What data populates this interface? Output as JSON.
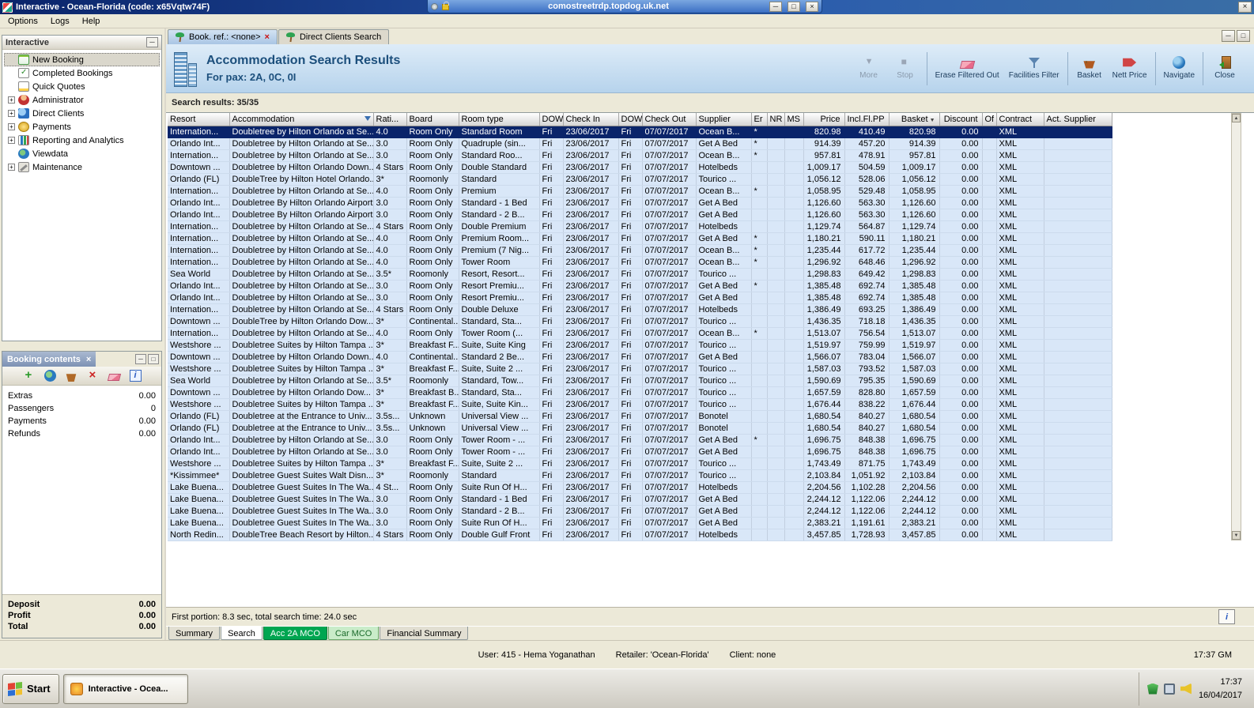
{
  "window": {
    "title": "Interactive - Ocean-Florida (code: x65Vqtw74F)",
    "rdp_title": "comostreetrdp.topdog.uk.net",
    "menu": [
      "Options",
      "Logs",
      "Help"
    ]
  },
  "sidebar": {
    "title": "Interactive",
    "items": [
      {
        "label": "New Booking",
        "icon": "ti-new-booking-icon",
        "expand": "",
        "selected": true
      },
      {
        "label": "Completed Bookings",
        "icon": "ti-completed-bookings-icon",
        "expand": ""
      },
      {
        "label": "Quick Quotes",
        "icon": "ti-quick-quotes-icon",
        "expand": ""
      },
      {
        "label": "Administrator",
        "icon": "ti-administrator-icon",
        "expand": "+"
      },
      {
        "label": "Direct Clients",
        "icon": "ti-direct-clients-icon",
        "expand": "+"
      },
      {
        "label": "Payments",
        "icon": "ti-payments-icon",
        "expand": "+"
      },
      {
        "label": "Reporting and Analytics",
        "icon": "ti-reporting-icon",
        "expand": "+"
      },
      {
        "label": "Viewdata",
        "icon": "ti-viewdata-icon",
        "expand": ""
      },
      {
        "label": "Maintenance",
        "icon": "ti-maintenance-icon",
        "expand": "+"
      }
    ]
  },
  "booking_contents": {
    "title": "Booking contents",
    "toolbar_icons": [
      "add-icon",
      "globe-icon",
      "basket-add-icon",
      "delete-icon",
      "eraser-icon",
      "info-icon"
    ],
    "items": [
      {
        "label": "Extras",
        "value": "0.00"
      },
      {
        "label": "Passengers",
        "value": "0"
      },
      {
        "label": "Payments",
        "value": "0.00"
      },
      {
        "label": "Refunds",
        "value": "0.00"
      }
    ],
    "totals": [
      {
        "label": "Deposit",
        "value": "0.00"
      },
      {
        "label": "Profit",
        "value": "0.00"
      },
      {
        "label": "Total",
        "value": "0.00"
      }
    ]
  },
  "tabs": [
    {
      "label": "Book. ref.: <none>",
      "active": true,
      "closable": true
    },
    {
      "label": "Direct Clients Search",
      "active": false,
      "closable": false
    }
  ],
  "header": {
    "title": "Accommodation Search Results",
    "subtitle": "For pax: 2A, 0C, 0I",
    "toolbar": [
      {
        "label": "More",
        "icon": "more-icon",
        "disabled": true
      },
      {
        "label": "Stop",
        "icon": "stop-icon",
        "disabled": true,
        "sep": true
      },
      {
        "label": "Erase Filtered Out",
        "icon": "eraser-red-icon"
      },
      {
        "label": "Facilities Filter",
        "icon": "filter-icon",
        "sep": true
      },
      {
        "label": "Basket",
        "icon": "basket-brown-icon"
      },
      {
        "label": "Nett Price",
        "icon": "nett-price-icon",
        "sep": true
      },
      {
        "label": "Navigate",
        "icon": "navigate-icon",
        "sep": true
      },
      {
        "label": "Close",
        "icon": "door-icon"
      }
    ]
  },
  "results": {
    "summary": "Search results: 35/35",
    "columns": [
      "Resort",
      "Accommodation",
      "Rati...",
      "Board",
      "Room type",
      "DOW",
      "Check In",
      "DOW",
      "Check Out",
      "Supplier",
      "Er",
      "NR",
      "MS",
      "Price",
      "Incl.Fl.PP",
      "Basket",
      "Discount",
      "Of",
      "Contract",
      "Act. Supplier"
    ],
    "selected_row": 0,
    "status": "First portion: 8.3 sec, total search time: 24.0 sec",
    "rows": [
      [
        "Internation...",
        "Doubletree by Hilton Orlando at Se...",
        "4.0",
        "Room Only",
        "Standard Room",
        "Fri",
        "23/06/2017",
        "Fri",
        "07/07/2017",
        "Ocean B...",
        "*",
        "",
        "",
        "820.98",
        "410.49",
        "820.98",
        "0.00",
        "",
        "XML",
        ""
      ],
      [
        "Orlando Int...",
        "Doubletree by Hilton Orlando at Se...",
        "3.0",
        "Room Only",
        "Quadruple (sin...",
        "Fri",
        "23/06/2017",
        "Fri",
        "07/07/2017",
        "Get A Bed",
        "*",
        "",
        "",
        "914.39",
        "457.20",
        "914.39",
        "0.00",
        "",
        "XML",
        ""
      ],
      [
        "Internation...",
        "Doubletree by Hilton Orlando at Se...",
        "3.0",
        "Room Only",
        "Standard Roo...",
        "Fri",
        "23/06/2017",
        "Fri",
        "07/07/2017",
        "Ocean B...",
        "*",
        "",
        "",
        "957.81",
        "478.91",
        "957.81",
        "0.00",
        "",
        "XML",
        ""
      ],
      [
        "Downtown ...",
        "Doubletree by Hilton Orlando Down...",
        "4 Stars",
        "Room Only",
        "Double Standard",
        "Fri",
        "23/06/2017",
        "Fri",
        "07/07/2017",
        "Hotelbeds",
        "",
        "",
        "",
        "1,009.17",
        "504.59",
        "1,009.17",
        "0.00",
        "",
        "XML",
        ""
      ],
      [
        "Orlando (FL)",
        "DoubleTree by Hilton Hotel Orlando...",
        "3*",
        "Roomonly",
        "Standard",
        "Fri",
        "23/06/2017",
        "Fri",
        "07/07/2017",
        "Tourico ...",
        "",
        "",
        "",
        "1,056.12",
        "528.06",
        "1,056.12",
        "0.00",
        "",
        "XML",
        ""
      ],
      [
        "Internation...",
        "Doubletree by Hilton Orlando at Se...",
        "4.0",
        "Room Only",
        "Premium",
        "Fri",
        "23/06/2017",
        "Fri",
        "07/07/2017",
        "Ocean B...",
        "*",
        "",
        "",
        "1,058.95",
        "529.48",
        "1,058.95",
        "0.00",
        "",
        "XML",
        ""
      ],
      [
        "Orlando Int...",
        "Doubletree By Hilton Orlando Airport",
        "3.0",
        "Room Only",
        "Standard - 1 Bed",
        "Fri",
        "23/06/2017",
        "Fri",
        "07/07/2017",
        "Get A Bed",
        "",
        "",
        "",
        "1,126.60",
        "563.30",
        "1,126.60",
        "0.00",
        "",
        "XML",
        ""
      ],
      [
        "Orlando Int...",
        "Doubletree By Hilton Orlando Airport",
        "3.0",
        "Room Only",
        "Standard - 2 B...",
        "Fri",
        "23/06/2017",
        "Fri",
        "07/07/2017",
        "Get A Bed",
        "",
        "",
        "",
        "1,126.60",
        "563.30",
        "1,126.60",
        "0.00",
        "",
        "XML",
        ""
      ],
      [
        "Internation...",
        "Doubletree by Hilton Orlando at Se...",
        "4 Stars",
        "Room Only",
        "Double Premium",
        "Fri",
        "23/06/2017",
        "Fri",
        "07/07/2017",
        "Hotelbeds",
        "",
        "",
        "",
        "1,129.74",
        "564.87",
        "1,129.74",
        "0.00",
        "",
        "XML",
        ""
      ],
      [
        "Internation...",
        "Doubletree by Hilton Orlando at Se...",
        "4.0",
        "Room Only",
        "Premium Room...",
        "Fri",
        "23/06/2017",
        "Fri",
        "07/07/2017",
        "Get A Bed",
        "*",
        "",
        "",
        "1,180.21",
        "590.11",
        "1,180.21",
        "0.00",
        "",
        "XML",
        ""
      ],
      [
        "Internation...",
        "Doubletree by Hilton Orlando at Se...",
        "4.0",
        "Room Only",
        "Premium (7 Nig...",
        "Fri",
        "23/06/2017",
        "Fri",
        "07/07/2017",
        "Ocean B...",
        "*",
        "",
        "",
        "1,235.44",
        "617.72",
        "1,235.44",
        "0.00",
        "",
        "XML",
        ""
      ],
      [
        "Internation...",
        "Doubletree by Hilton Orlando at Se...",
        "4.0",
        "Room Only",
        "Tower Room",
        "Fri",
        "23/06/2017",
        "Fri",
        "07/07/2017",
        "Ocean B...",
        "*",
        "",
        "",
        "1,296.92",
        "648.46",
        "1,296.92",
        "0.00",
        "",
        "XML",
        ""
      ],
      [
        "Sea World",
        "Doubletree by Hilton Orlando at Se...",
        "3.5*",
        "Roomonly",
        "Resort, Resort...",
        "Fri",
        "23/06/2017",
        "Fri",
        "07/07/2017",
        "Tourico ...",
        "",
        "",
        "",
        "1,298.83",
        "649.42",
        "1,298.83",
        "0.00",
        "",
        "XML",
        ""
      ],
      [
        "Orlando Int...",
        "Doubletree by Hilton Orlando at Se...",
        "3.0",
        "Room Only",
        "Resort Premiu...",
        "Fri",
        "23/06/2017",
        "Fri",
        "07/07/2017",
        "Get A Bed",
        "*",
        "",
        "",
        "1,385.48",
        "692.74",
        "1,385.48",
        "0.00",
        "",
        "XML",
        ""
      ],
      [
        "Orlando Int...",
        "Doubletree by Hilton Orlando at Se...",
        "3.0",
        "Room Only",
        "Resort Premiu...",
        "Fri",
        "23/06/2017",
        "Fri",
        "07/07/2017",
        "Get A Bed",
        "",
        "",
        "",
        "1,385.48",
        "692.74",
        "1,385.48",
        "0.00",
        "",
        "XML",
        ""
      ],
      [
        "Internation...",
        "Doubletree by Hilton Orlando at Se...",
        "4 Stars",
        "Room Only",
        "Double Deluxe",
        "Fri",
        "23/06/2017",
        "Fri",
        "07/07/2017",
        "Hotelbeds",
        "",
        "",
        "",
        "1,386.49",
        "693.25",
        "1,386.49",
        "0.00",
        "",
        "XML",
        ""
      ],
      [
        "Downtown ...",
        "DoubleTree by Hilton Orlando Dow...",
        "3*",
        "Continental...",
        "Standard, Sta...",
        "Fri",
        "23/06/2017",
        "Fri",
        "07/07/2017",
        "Tourico ...",
        "",
        "",
        "",
        "1,436.35",
        "718.18",
        "1,436.35",
        "0.00",
        "",
        "XML",
        ""
      ],
      [
        "Internation...",
        "Doubletree by Hilton Orlando at Se...",
        "4.0",
        "Room Only",
        "Tower Room (...",
        "Fri",
        "23/06/2017",
        "Fri",
        "07/07/2017",
        "Ocean B...",
        "*",
        "",
        "",
        "1,513.07",
        "756.54",
        "1,513.07",
        "0.00",
        "",
        "XML",
        ""
      ],
      [
        "Westshore ...",
        "Doubletree Suites by Hilton Tampa ...",
        "3*",
        "Breakfast F...",
        "Suite, Suite King",
        "Fri",
        "23/06/2017",
        "Fri",
        "07/07/2017",
        "Tourico ...",
        "",
        "",
        "",
        "1,519.97",
        "759.99",
        "1,519.97",
        "0.00",
        "",
        "XML",
        ""
      ],
      [
        "Downtown ...",
        "Doubletree by Hilton Orlando Down...",
        "4.0",
        "Continental...",
        "Standard 2 Be...",
        "Fri",
        "23/06/2017",
        "Fri",
        "07/07/2017",
        "Get A Bed",
        "",
        "",
        "",
        "1,566.07",
        "783.04",
        "1,566.07",
        "0.00",
        "",
        "XML",
        ""
      ],
      [
        "Westshore ...",
        "Doubletree Suites by Hilton Tampa ...",
        "3*",
        "Breakfast F...",
        "Suite, Suite 2 ...",
        "Fri",
        "23/06/2017",
        "Fri",
        "07/07/2017",
        "Tourico ...",
        "",
        "",
        "",
        "1,587.03",
        "793.52",
        "1,587.03",
        "0.00",
        "",
        "XML",
        ""
      ],
      [
        "Sea World",
        "Doubletree by Hilton Orlando at Se...",
        "3.5*",
        "Roomonly",
        "Standard, Tow...",
        "Fri",
        "23/06/2017",
        "Fri",
        "07/07/2017",
        "Tourico ...",
        "",
        "",
        "",
        "1,590.69",
        "795.35",
        "1,590.69",
        "0.00",
        "",
        "XML",
        ""
      ],
      [
        "Downtown ...",
        "Doubletree by Hilton Orlando Dow...",
        "3*",
        "Breakfast B...",
        "Standard, Sta...",
        "Fri",
        "23/06/2017",
        "Fri",
        "07/07/2017",
        "Tourico ...",
        "",
        "",
        "",
        "1,657.59",
        "828.80",
        "1,657.59",
        "0.00",
        "",
        "XML",
        ""
      ],
      [
        "Westshore ...",
        "Doubletree Suites by Hilton Tampa ...",
        "3*",
        "Breakfast F...",
        "Suite, Suite Kin...",
        "Fri",
        "23/06/2017",
        "Fri",
        "07/07/2017",
        "Tourico ...",
        "",
        "",
        "",
        "1,676.44",
        "838.22",
        "1,676.44",
        "0.00",
        "",
        "XML",
        ""
      ],
      [
        "Orlando (FL)",
        "Doubletree at the Entrance to Univ...",
        "3.5s...",
        "Unknown",
        "Universal View ...",
        "Fri",
        "23/06/2017",
        "Fri",
        "07/07/2017",
        "Bonotel",
        "",
        "",
        "",
        "1,680.54",
        "840.27",
        "1,680.54",
        "0.00",
        "",
        "XML",
        ""
      ],
      [
        "Orlando (FL)",
        "Doubletree at the Entrance to Univ...",
        "3.5s...",
        "Unknown",
        "Universal View ...",
        "Fri",
        "23/06/2017",
        "Fri",
        "07/07/2017",
        "Bonotel",
        "",
        "",
        "",
        "1,680.54",
        "840.27",
        "1,680.54",
        "0.00",
        "",
        "XML",
        ""
      ],
      [
        "Orlando Int...",
        "Doubletree by Hilton Orlando at Se...",
        "3.0",
        "Room Only",
        "Tower Room - ...",
        "Fri",
        "23/06/2017",
        "Fri",
        "07/07/2017",
        "Get A Bed",
        "*",
        "",
        "",
        "1,696.75",
        "848.38",
        "1,696.75",
        "0.00",
        "",
        "XML",
        ""
      ],
      [
        "Orlando Int...",
        "Doubletree by Hilton Orlando at Se...",
        "3.0",
        "Room Only",
        "Tower Room - ...",
        "Fri",
        "23/06/2017",
        "Fri",
        "07/07/2017",
        "Get A Bed",
        "",
        "",
        "",
        "1,696.75",
        "848.38",
        "1,696.75",
        "0.00",
        "",
        "XML",
        ""
      ],
      [
        "Westshore ...",
        "Doubletree Suites by Hilton Tampa ...",
        "3*",
        "Breakfast F...",
        "Suite, Suite 2 ...",
        "Fri",
        "23/06/2017",
        "Fri",
        "07/07/2017",
        "Tourico ...",
        "",
        "",
        "",
        "1,743.49",
        "871.75",
        "1,743.49",
        "0.00",
        "",
        "XML",
        ""
      ],
      [
        "*Kissimmee*",
        "Doubletree Guest Suites Walt Disn...",
        "3*",
        "Roomonly",
        "Standard",
        "Fri",
        "23/06/2017",
        "Fri",
        "07/07/2017",
        "Tourico ...",
        "",
        "",
        "",
        "2,103.84",
        "1,051.92",
        "2,103.84",
        "0.00",
        "",
        "XML",
        ""
      ],
      [
        "Lake Buena...",
        "Doubletree Guest Suites In The Wa...",
        "4 St...",
        "Room Only",
        "Suite Run Of H...",
        "Fri",
        "23/06/2017",
        "Fri",
        "07/07/2017",
        "Hotelbeds",
        "",
        "",
        "",
        "2,204.56",
        "1,102.28",
        "2,204.56",
        "0.00",
        "",
        "XML",
        ""
      ],
      [
        "Lake Buena...",
        "Doubletree Guest Suites In The Wa...",
        "3.0",
        "Room Only",
        "Standard - 1 Bed",
        "Fri",
        "23/06/2017",
        "Fri",
        "07/07/2017",
        "Get A Bed",
        "",
        "",
        "",
        "2,244.12",
        "1,122.06",
        "2,244.12",
        "0.00",
        "",
        "XML",
        ""
      ],
      [
        "Lake Buena...",
        "Doubletree Guest Suites In The Wa...",
        "3.0",
        "Room Only",
        "Standard - 2 B...",
        "Fri",
        "23/06/2017",
        "Fri",
        "07/07/2017",
        "Get A Bed",
        "",
        "",
        "",
        "2,244.12",
        "1,122.06",
        "2,244.12",
        "0.00",
        "",
        "XML",
        ""
      ],
      [
        "Lake Buena...",
        "Doubletree Guest Suites In The Wa...",
        "3.0",
        "Room Only",
        "Suite Run Of H...",
        "Fri",
        "23/06/2017",
        "Fri",
        "07/07/2017",
        "Get A Bed",
        "",
        "",
        "",
        "2,383.21",
        "1,191.61",
        "2,383.21",
        "0.00",
        "",
        "XML",
        ""
      ],
      [
        "North Redin...",
        "DoubleTree Beach Resort by Hilton...",
        "4 Stars",
        "Room Only",
        "Double Gulf Front",
        "Fri",
        "23/06/2017",
        "Fri",
        "07/07/2017",
        "Hotelbeds",
        "",
        "",
        "",
        "3,457.85",
        "1,728.93",
        "3,457.85",
        "0.00",
        "",
        "XML",
        ""
      ]
    ]
  },
  "bottom_tabs": [
    {
      "label": "Summary",
      "style": ""
    },
    {
      "label": "Search",
      "style": "active"
    },
    {
      "label": "Acc 2A MCO",
      "style": "green-dark"
    },
    {
      "label": "Car MCO",
      "style": "green-light"
    },
    {
      "label": "Financial Summary",
      "style": ""
    }
  ],
  "status_bar": {
    "user": "User: 415 - Hema Yoganathan",
    "retailer": "Retailer: 'Ocean-Florida'",
    "client": "Client: none",
    "time": "17:37 GM"
  },
  "taskbar": {
    "start": "Start",
    "task": "Interactive - Ocea...",
    "tray_icons": [
      "antivirus-icon",
      "display-icon",
      "volume-icon"
    ],
    "time": "17:37",
    "date": "16/04/2017"
  }
}
